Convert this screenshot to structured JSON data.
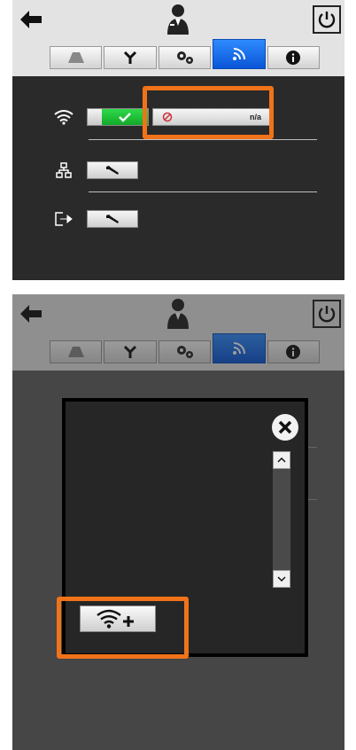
{
  "screens": [
    {
      "header": {
        "back_icon": "arrow-left-icon",
        "user_icon": "user-icon",
        "power_icon": "power-icon"
      },
      "tabs": [
        {
          "icon": "probe-icon",
          "active": false
        },
        {
          "icon": "y-connector-icon",
          "active": false
        },
        {
          "icon": "gears-icon",
          "active": false
        },
        {
          "icon": "wireless-icon",
          "active": true
        },
        {
          "icon": "info-icon",
          "active": false
        }
      ],
      "rows": [
        {
          "icon": "wifi-icon",
          "toggle": "on",
          "status": "n/a",
          "status_icon": "disabled-icon"
        },
        {
          "icon": "network-icon",
          "button_icon": "wrench-icon"
        },
        {
          "icon": "export-icon",
          "button_icon": "wrench-icon"
        }
      ],
      "highlight_color": "#f0731a"
    },
    {
      "dialog": {
        "close_icon": "close-icon",
        "scroll_up_icon": "chevron-up-icon",
        "scroll_down_icon": "chevron-down-icon",
        "add_network_icon": "wifi-add-icon"
      },
      "dimmed": true,
      "highlight_color": "#f0731a"
    }
  ]
}
